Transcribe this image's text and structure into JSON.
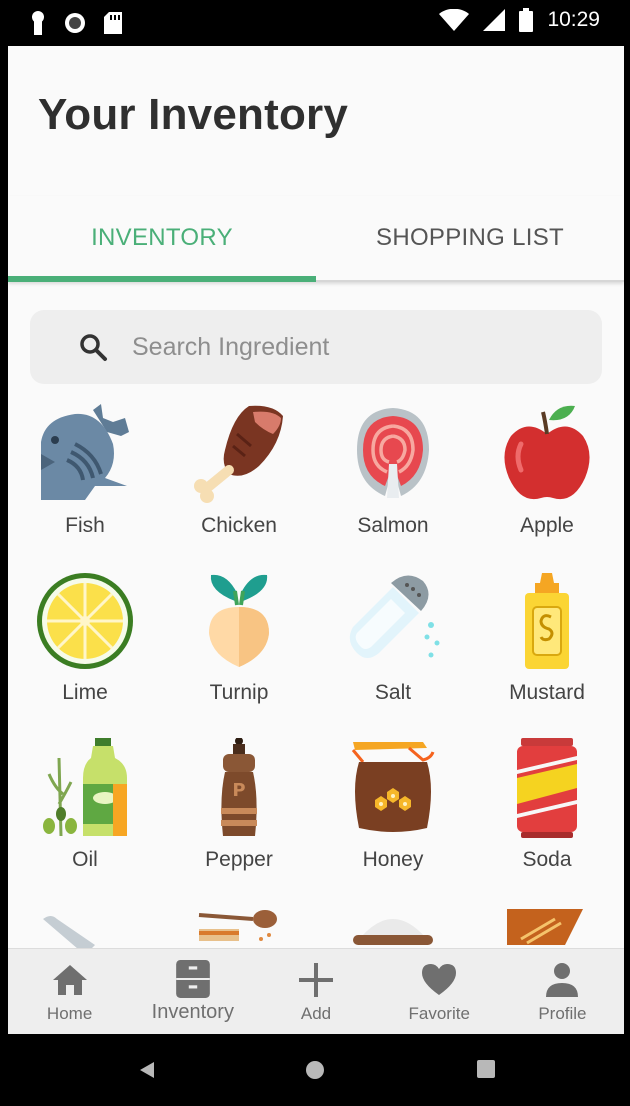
{
  "status": {
    "time": "10:29"
  },
  "page": {
    "title": "Your Inventory"
  },
  "tabs": [
    {
      "label": "INVENTORY",
      "active": true
    },
    {
      "label": "SHOPPING LIST",
      "active": false
    }
  ],
  "search": {
    "placeholder": "Search Ingredient",
    "value": ""
  },
  "ingredients": [
    {
      "label": "Fish",
      "icon": "fish-icon"
    },
    {
      "label": "Chicken",
      "icon": "chicken-leg-icon"
    },
    {
      "label": "Salmon",
      "icon": "salmon-steak-icon"
    },
    {
      "label": "Apple",
      "icon": "apple-icon"
    },
    {
      "label": "Lime",
      "icon": "lime-icon"
    },
    {
      "label": "Turnip",
      "icon": "turnip-icon"
    },
    {
      "label": "Salt",
      "icon": "salt-shaker-icon"
    },
    {
      "label": "Mustard",
      "icon": "mustard-bottle-icon"
    },
    {
      "label": "Oil",
      "icon": "oil-bottle-icon"
    },
    {
      "label": "Pepper",
      "icon": "pepper-grinder-icon"
    },
    {
      "label": "Honey",
      "icon": "honey-jar-icon"
    },
    {
      "label": "Soda",
      "icon": "soda-can-icon"
    }
  ],
  "bottom_nav": [
    {
      "label": "Home",
      "icon": "home-icon",
      "active": false
    },
    {
      "label": "Inventory",
      "icon": "cabinet-icon",
      "active": true
    },
    {
      "label": "Add",
      "icon": "plus-icon",
      "active": false
    },
    {
      "label": "Favorite",
      "icon": "heart-icon",
      "active": false
    },
    {
      "label": "Profile",
      "icon": "person-icon",
      "active": false
    }
  ],
  "colors": {
    "accent": "#4aaf78",
    "text_dark": "#2f2f2f",
    "nav_icon": "#6f6f6f"
  }
}
